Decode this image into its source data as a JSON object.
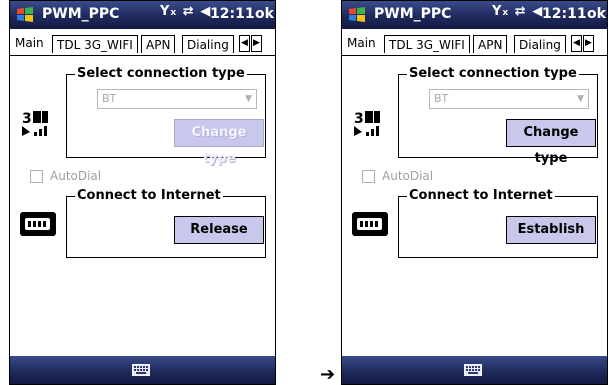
{
  "screens": [
    {
      "title": "PWM_PPC",
      "time": "12:11",
      "ok_label": "ok",
      "status_icons": "Ÿₕ ⇄ ◁\"",
      "tabs": [
        "Main",
        "TDL 3G_WIFI",
        "APN",
        "Dialing"
      ],
      "select_group_label": "Select connection type",
      "combo_value": "BT",
      "change_type_label": "Change type",
      "change_type_enabled": false,
      "autodial_label": "AutoDial",
      "connect_group_label": "Connect to Internet",
      "connect_button_label": "Release"
    },
    {
      "title": "PWM_PPC",
      "time": "12:11",
      "ok_label": "ok",
      "status_icons": "Ÿₕ ⇄ ◁\"",
      "tabs": [
        "Main",
        "TDL 3G_WIFI",
        "APN",
        "Dialing"
      ],
      "select_group_label": "Select connection type",
      "combo_value": "BT",
      "change_type_label": "Change type",
      "change_type_enabled": true,
      "autodial_label": "AutoDial",
      "connect_group_label": "Connect to Internet",
      "connect_button_label": "Establish"
    }
  ],
  "transition_arrow": "➔",
  "colors": {
    "bar_top": "#3a4b8a",
    "bar_bottom": "#131a44",
    "button_fill": "#c8c8ec"
  }
}
